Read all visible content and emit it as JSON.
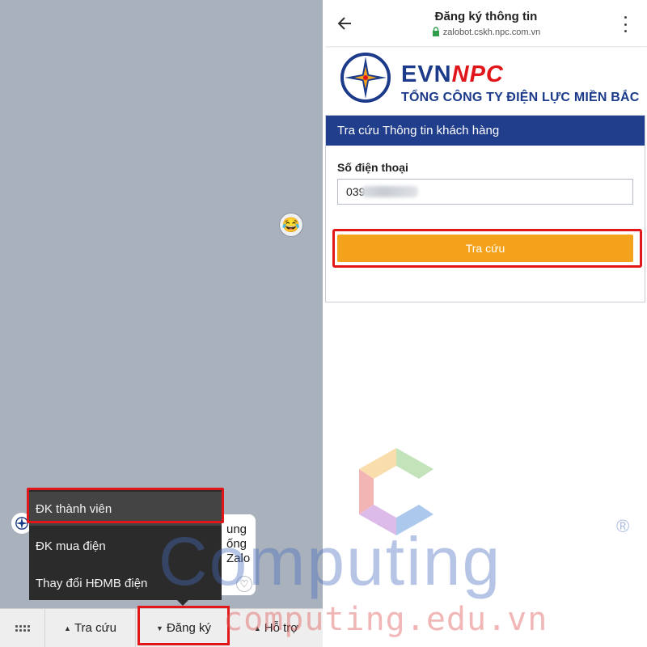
{
  "left_panel": {
    "emoji": "😂",
    "bubble_text": "ung\nống\nZalo",
    "popup_menu": {
      "items": [
        {
          "label": "ĐK thành viên"
        },
        {
          "label": "ĐK mua điện"
        },
        {
          "label": "Thay đổi HĐMB điện"
        }
      ]
    },
    "bottom_tabs": [
      {
        "label": "Tra cứu",
        "icon": "triangle-up-icon"
      },
      {
        "label": "Đăng ký",
        "icon": "triangle-down-icon"
      },
      {
        "label": "Hỗ trợ",
        "icon": "triangle-up-icon"
      }
    ]
  },
  "right_panel": {
    "header": {
      "title": "Đăng ký thông tin",
      "url": "zalobot.cskh.npc.com.vn"
    },
    "logo": {
      "brand_evn": "EVN",
      "brand_npc": "NPC",
      "subtitle": "TỔNG CÔNG TY ĐIỆN LỰC MIỀN BẮC"
    },
    "form": {
      "section_title": "Tra cứu Thông tin khách hàng",
      "phone_label": "Số điện thoại",
      "phone_value": "039",
      "submit_label": "Tra cứu"
    }
  },
  "watermark": {
    "word": "Computing",
    "url": "computing.edu.vn",
    "reg": "®"
  },
  "colors": {
    "highlight": "#e0161a",
    "brand_blue": "#213e8c",
    "button_orange": "#f4a21b",
    "chat_background": "#a9b1bd"
  }
}
